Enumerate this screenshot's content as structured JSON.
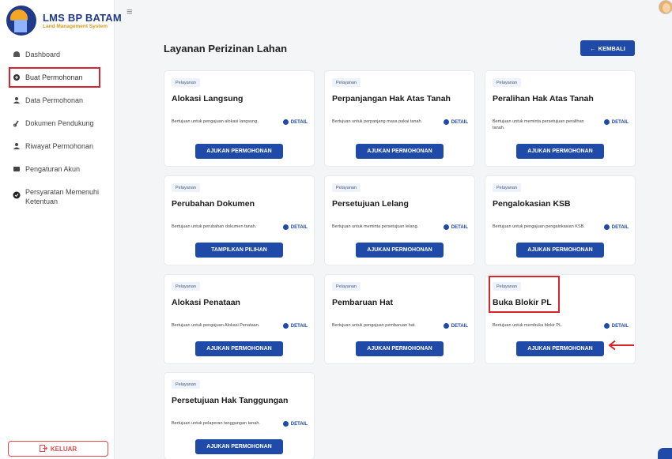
{
  "app": {
    "title": "LMS BP BATAM",
    "subtitle": "Land Management System"
  },
  "sidebar": {
    "items": [
      {
        "label": "Dashboard",
        "icon": "dashboard-icon"
      },
      {
        "label": "Buat Permohonan",
        "icon": "create-request-icon"
      },
      {
        "label": "Data Permohonan",
        "icon": "data-request-icon"
      },
      {
        "label": "Dokumen Pendukung",
        "icon": "document-link-icon"
      },
      {
        "label": "Riwayat Permohonan",
        "icon": "history-icon"
      },
      {
        "label": "Pengaturan Akun",
        "icon": "account-settings-icon"
      },
      {
        "label": "Persyaratan Memenuhi Ketentuan",
        "icon": "requirements-check-icon"
      }
    ],
    "logout_label": "KELUAR"
  },
  "main": {
    "title": "Layanan Perizinan Lahan",
    "back_label": "KEMBALI",
    "cards": [
      {
        "tag": "Pelayanan",
        "title": "Alokasi Langsung",
        "desc": "Bertujuan untuk pengajuan alokasi langsung.",
        "detail": "DETAIL",
        "button": "AJUKAN PERMOHONAN"
      },
      {
        "tag": "Pelayanan",
        "title": "Perpanjangan Hak Atas Tanah",
        "desc": "Bertujuan untuk perpanjang masa pakai tanah.",
        "detail": "DETAIL",
        "button": "AJUKAN PERMOHONAN"
      },
      {
        "tag": "Pelayanan",
        "title": "Peralihan Hak Atas Tanah",
        "desc": "Bertujuan untuk meminta persetujuan peralihan tanah.",
        "detail": "DETAIL",
        "button": "AJUKAN PERMOHONAN"
      },
      {
        "tag": "Pelayanan",
        "title": "Perubahan Dokumen",
        "desc": "Bertujuan untuk perubahan dokumen tanah.",
        "detail": "DETAIL",
        "button": "TAMPILKAN PILIHAN"
      },
      {
        "tag": "Pelayanan",
        "title": "Persetujuan Lelang",
        "desc": "Bertujuan untuk meminta persetujuan lelang.",
        "detail": "DETAIL",
        "button": "AJUKAN PERMOHONAN"
      },
      {
        "tag": "Pelayanan",
        "title": "Pengalokasian KSB",
        "desc": "Bertujuan untuk pengajuan pengalokasian KSB.",
        "detail": "DETAIL",
        "button": "AJUKAN PERMOHONAN"
      },
      {
        "tag": "Pelayanan",
        "title": "Alokasi Penataan",
        "desc": "Bertujuan untuk pengajuan Alokasi Penataan.",
        "detail": "DETAIL",
        "button": "AJUKAN PERMOHONAN"
      },
      {
        "tag": "Pelayanan",
        "title": "Pembaruan Hat",
        "desc": "Bertujuan untuk pengajuan pembaruan hat.",
        "detail": "DETAIL",
        "button": "AJUKAN PERMOHONAN"
      },
      {
        "tag": "Pelayanan",
        "title": "Buka Blokir PL",
        "desc": "Bertujuan untuk membuka blokir PL.",
        "detail": "DETAIL",
        "button": "AJUKAN PERMOHONAN"
      },
      {
        "tag": "Pelayanan",
        "title": "Persetujuan Hak Tanggungan",
        "desc": "Bertujuan untuk pelaporan tanggungan tanah.",
        "detail": "DETAIL",
        "button": "AJUKAN PERMOHONAN"
      }
    ]
  },
  "colors": {
    "primary": "#1f4aa8",
    "highlight": "#d9232e",
    "logout": "#e24a4a"
  }
}
